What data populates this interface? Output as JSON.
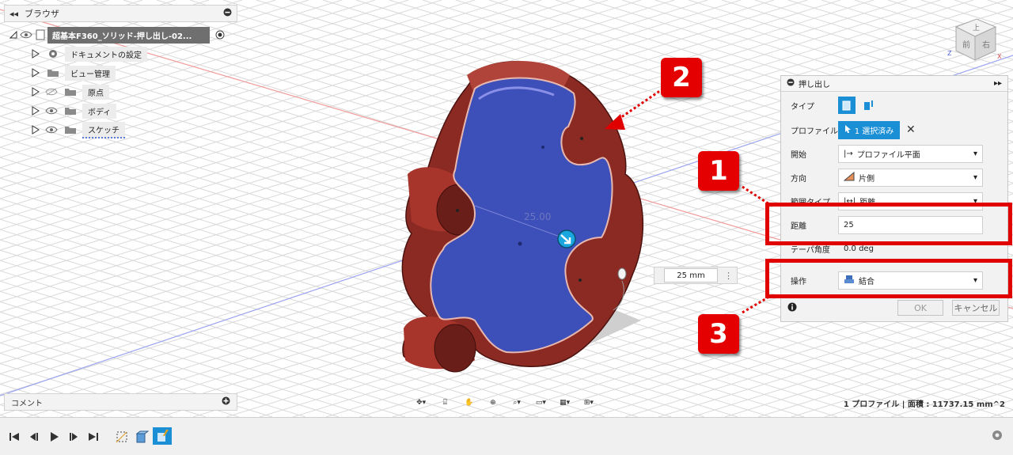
{
  "browser": {
    "title": "ブラウザ",
    "root": "超基本F360_ソリッド-押し出し-02...",
    "items": [
      {
        "label": "ドキュメントの設定",
        "icon": "gear-icon"
      },
      {
        "label": "ビュー管理",
        "icon": "folder-icon"
      },
      {
        "label": "原点",
        "icon": "folder-icon"
      },
      {
        "label": "ボディ",
        "icon": "folder-icon"
      },
      {
        "label": "スケッチ",
        "icon": "folder-icon"
      }
    ]
  },
  "comment": {
    "label": "コメント"
  },
  "dialog": {
    "title": "押し出し",
    "rows": {
      "type": {
        "label": "タイプ"
      },
      "profile": {
        "label": "プロファイル",
        "value": "1 選択済み"
      },
      "start": {
        "label": "開始",
        "value": "プロファイル平面"
      },
      "direction": {
        "label": "方向",
        "value": "片側"
      },
      "extent": {
        "label": "範囲タイプ",
        "value": "距離"
      },
      "distance": {
        "label": "距離",
        "value": "25"
      },
      "taper": {
        "label": "テーパ角度",
        "value": "0.0 deg"
      },
      "operation": {
        "label": "操作",
        "value": "結合"
      }
    },
    "ok": "OK",
    "cancel": "キャンセル"
  },
  "viewport": {
    "distance_input": "25 mm",
    "dimension_label": "25.00"
  },
  "callouts": [
    "1",
    "2",
    "3"
  ],
  "view_cube": {
    "face_top": "上",
    "face_front": "前",
    "face_right": "右",
    "axis_z": "Z",
    "axis_x": "X"
  },
  "status": "1 プロファイル | 面積 : 11737.15 mm^2",
  "colors": {
    "accent": "#1b8fd6",
    "highlight": "#e00000",
    "body_red": "#8b2a23",
    "profile_blue": "#3d4fb8"
  }
}
